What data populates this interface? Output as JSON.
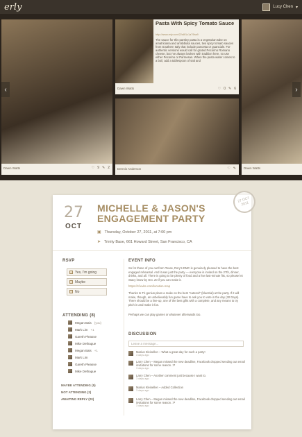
{
  "app": {
    "logo": "erly",
    "user_name": "Lucy Chen"
  },
  "photos": [
    {
      "author": "Dawn Watts",
      "likes": "9",
      "comments": "2"
    },
    {
      "author": "Dawn Watts",
      "likes": "0",
      "comments": "6"
    },
    {
      "author": "Dennis Anderson",
      "likes": "",
      "comments": ""
    },
    {
      "author": "Dawn Watts",
      "likes": "",
      "comments": ""
    }
  ],
  "recipe": {
    "title": "Pasta With Spicy Tomato Sauce",
    "url": "http://www.erly.com/22s8f1c1a79ba9",
    "text": "The sauce for this parsley pasta is a vegetarian take on amatriciana and arrabbiata sauces, two spicy tomato sauces from Southern Italy that include pancetta or guanciale. For authentic versions would call for grated Pecorino Romano cheese, but I've always broken with tradition here, so use either Pecorino or Parmesan. When the pasta water comes to a boil, add a tablespoon of salt and"
  },
  "event": {
    "day": "27",
    "month": "OCT",
    "title": "MICHELLE & JASON'S ENGAGEMENT PARTY",
    "when": "Thursday, October 27, 2011, at 7:00 pm",
    "where": "Trinity Base, 661 Howard Street, San Francisco, CA",
    "stamp": "27 OCT 2011"
  },
  "rsvp": {
    "heading": "RSVP",
    "options": [
      "Yes, I'm going",
      "Maybe",
      "No"
    ]
  },
  "attending": {
    "heading": "ATTENDING (8)",
    "people": [
      {
        "name": "Megan Bais",
        "note": "(you)"
      },
      {
        "name": "Mark Lim",
        "note": "+1"
      },
      {
        "name": "Gareth Pleasse",
        "note": ""
      },
      {
        "name": "Mike Dethague",
        "note": ""
      },
      {
        "name": "Megan Bais",
        "note": "+1"
      },
      {
        "name": "Mark Lim",
        "note": ""
      },
      {
        "name": "Gareth Pleasse",
        "note": ""
      },
      {
        "name": "Mike Dethague",
        "note": ""
      }
    ],
    "maybe": "MAYBE ATTENDING (5)",
    "not": "NOT ATTENDING (2)",
    "awaiting": "AWAITING REPLY (20)"
  },
  "info": {
    "heading": "EVENT INFO",
    "p1": "So for those of you out from Texas, Rory's DMC is genuinely pleased to have the best engaged rehearsal. And it was just the party — everyone is invited on the 27th, dinner, drinks, and all. There is going to be plenty of food and a few last-minute fits, so please let Stacy know by Oct. 20 if you can make it.",
    "link": "https://sf.evite.com/location-map",
    "p2": "Thanks to Tri-genius plans a make on the best \"catered\" (bluetrial) at the party. If it will make, though, an unbelievably fun game have to ask you to vote in the day (30 Days). There should be a line-up, one of the best gifts with a complete, and any means to try pitch in and make it fun.",
    "p3": "Perhaps we can play games or whatever afterwards too."
  },
  "discussion": {
    "heading": "DISCUSSION",
    "placeholder": "Leave a message...",
    "posts": [
      {
        "text": "Marius Kleinellen – What a great day for such a party!",
        "time": "3 days ago"
      },
      {
        "text": "Larry Chen – Megan missed the new deadline, Facebook dropped sending out email invitations for some reason. :P",
        "time": "3 days ago"
      },
      {
        "text": "Larry Chen – Another comment just because I want to.",
        "time": "3 days ago"
      },
      {
        "text": "Marius Kleinellen – Added Collection",
        "time": "3 days ago"
      },
      {
        "text": "Larry Chen – Megan missed the new deadline, Facebook dropped sending out email invitations for some reason. :P",
        "time": "3 days ago"
      }
    ]
  }
}
